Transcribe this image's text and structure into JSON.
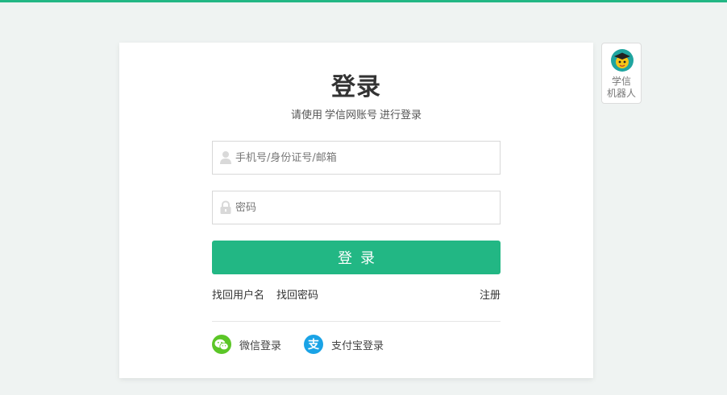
{
  "login": {
    "title": "登录",
    "subtitle_prefix": "请使用",
    "subtitle_brand": "学信网账号",
    "subtitle_suffix": "进行登录",
    "username_placeholder": "手机号/身份证号/邮箱",
    "password_placeholder": "密码",
    "submit_label": "登录",
    "find_username": "找回用户名",
    "find_password": "找回密码",
    "register": "注册",
    "wechat_login": "微信登录",
    "alipay_login": "支付宝登录",
    "alipay_glyph": "支"
  },
  "robot": {
    "line1": "学信",
    "line2": "机器人"
  },
  "colors": {
    "accent": "#22b784",
    "wechat": "#5bc627",
    "alipay": "#1aa3e6"
  }
}
